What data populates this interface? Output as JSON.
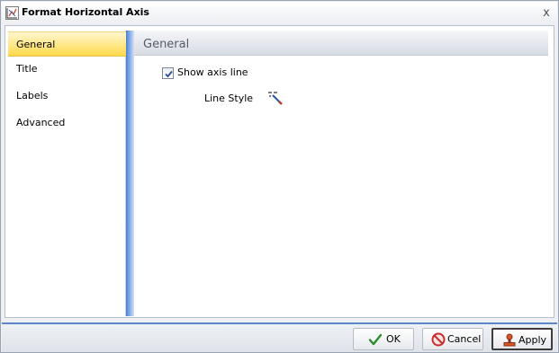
{
  "window": {
    "title": "Format Horizontal Axis",
    "close_glyph": "x"
  },
  "nav": {
    "items": [
      {
        "label": "General",
        "selected": true
      },
      {
        "label": "Title",
        "selected": false
      },
      {
        "label": "Labels",
        "selected": false
      },
      {
        "label": "Advanced",
        "selected": false
      }
    ]
  },
  "general": {
    "header": "General",
    "show_axis_line_label": "Show axis line",
    "show_axis_line_checked": true,
    "line_style_label": "Line Style",
    "line_style_icon": "line-style-icon"
  },
  "buttons": {
    "ok_label": "OK",
    "cancel_label": "Cancel",
    "apply_label": "Apply"
  },
  "colors": {
    "selected_nav": "#ffe680",
    "splitter": "#4a7ed0",
    "ok_check": "#2e8b2e",
    "cancel_red": "#cc2a2a"
  }
}
